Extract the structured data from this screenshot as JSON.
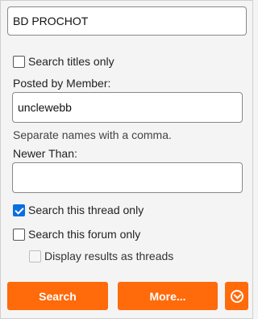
{
  "query": {
    "value": "BD PROCHOT"
  },
  "options": {
    "search_titles_only": {
      "label": "Search titles only",
      "checked": false
    },
    "posted_by": {
      "label": "Posted by Member:",
      "value": "unclewebb",
      "hint": "Separate names with a comma."
    },
    "newer_than": {
      "label": "Newer Than:",
      "value": ""
    },
    "search_thread_only": {
      "label": "Search this thread only",
      "checked": true
    },
    "search_forum_only": {
      "label": "Search this forum only",
      "checked": false
    },
    "display_as_threads": {
      "label": "Display results as threads",
      "checked": false,
      "disabled": true
    }
  },
  "buttons": {
    "search": "Search",
    "more": "More...",
    "toggle_icon": "chevron-down-circle-icon"
  },
  "colors": {
    "accent": "#ff6a0a",
    "checkbox_checked": "#0a6fe0"
  }
}
